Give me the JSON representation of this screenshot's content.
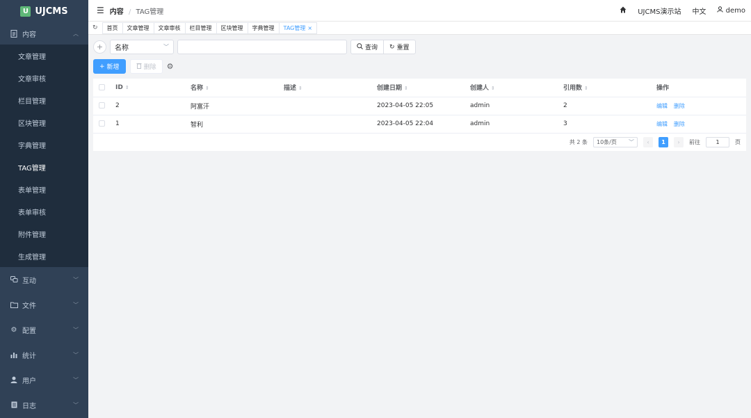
{
  "app": {
    "logo_mark": "U",
    "logo_text": "UJCMS"
  },
  "sidebar": {
    "groups": [
      {
        "label": "内容",
        "icon": "document-icon"
      },
      {
        "label": "互动",
        "icon": "chat-icon"
      },
      {
        "label": "文件",
        "icon": "folder-icon"
      },
      {
        "label": "配置",
        "icon": "gear-icon"
      },
      {
        "label": "统计",
        "icon": "bar-chart-icon"
      },
      {
        "label": "用户",
        "icon": "user-icon"
      },
      {
        "label": "日志",
        "icon": "log-icon"
      }
    ],
    "content_items": [
      "文章管理",
      "文章审核",
      "栏目管理",
      "区块管理",
      "字典管理",
      "TAG管理",
      "表单管理",
      "表单审核",
      "附件管理",
      "生成管理"
    ],
    "active_item": "TAG管理"
  },
  "header": {
    "breadcrumb_parent": "内容",
    "breadcrumb_sep": "/",
    "breadcrumb_current": "TAG管理",
    "site_label": "UJCMS演示站",
    "language": "中文",
    "user": "demo"
  },
  "tabs": [
    "首页",
    "文章管理",
    "文章审核",
    "栏目管理",
    "区块管理",
    "字典管理",
    "TAG管理"
  ],
  "filter": {
    "field_select": "名称",
    "search_value": "",
    "query_label": "查询",
    "reset_label": "重置"
  },
  "actions": {
    "add_label": "新增",
    "delete_label": "删除"
  },
  "table": {
    "columns": [
      "ID",
      "名称",
      "描述",
      "创建日期",
      "创建人",
      "引用数",
      "操作"
    ],
    "rows": [
      {
        "id": "2",
        "name": "阿富汗",
        "desc": "",
        "created": "2023-04-05 22:05",
        "creator": "admin",
        "refs": "2"
      },
      {
        "id": "1",
        "name": "智利",
        "desc": "",
        "created": "2023-04-05 22:04",
        "creator": "admin",
        "refs": "3"
      }
    ],
    "op_edit": "编辑",
    "op_delete": "删除"
  },
  "pager": {
    "total": "共 2 条",
    "page_size": "10条/页",
    "current_page": "1",
    "goto_label": "前往",
    "goto_value": "1",
    "page_unit": "页"
  },
  "colors": {
    "sidebar_bg": "#304156",
    "accent": "#409eff"
  }
}
